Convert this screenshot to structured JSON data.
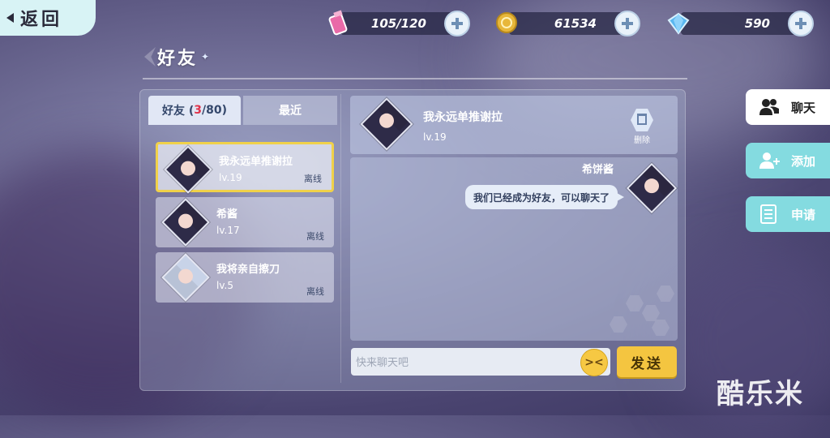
{
  "back_label": "返回",
  "resources": {
    "stamina": {
      "value": "105/120",
      "icon": "stamina-bottle-icon",
      "color": "#e96aa8"
    },
    "gold": {
      "value": "61534",
      "icon": "gold-coin-icon",
      "color": "#e8b73a"
    },
    "crystal": {
      "value": "590",
      "icon": "crystal-icon",
      "color": "#5ab7f0"
    }
  },
  "page_title": "好友",
  "tabs": {
    "friends": {
      "label": "好友 (",
      "count": "3",
      "max": "/80)"
    },
    "recent": {
      "label": "最近"
    }
  },
  "friends": [
    {
      "name": "我永远单推谢拉",
      "level": "lv.19",
      "status": "离线",
      "selected": true
    },
    {
      "name": "希酱",
      "level": "lv.17",
      "status": "离线",
      "selected": false
    },
    {
      "name": "我将亲自擦刀",
      "level": "lv.5",
      "status": "离线",
      "selected": false
    }
  ],
  "chat": {
    "partner_name": "我永远单推谢拉",
    "partner_level": "lv.19",
    "delete_label": "删除",
    "messages": [
      {
        "sender": "希饼酱",
        "text": "我们已经成为好友，可以聊天了"
      }
    ],
    "input_placeholder": "快来聊天吧",
    "emoji_label": "><",
    "send_label": "发送"
  },
  "side_tabs": [
    {
      "label": "聊天",
      "icon": "people-icon",
      "active": true
    },
    {
      "label": "添加",
      "icon": "add-user-icon",
      "active": false
    },
    {
      "label": "申请",
      "icon": "request-list-icon",
      "active": false
    }
  ],
  "watermark": "酷乐米",
  "colors": {
    "accent_teal": "#84dbe0",
    "send_yellow": "#f4c540",
    "selected_border": "#f0d14a",
    "count_red": "#e0334b"
  }
}
